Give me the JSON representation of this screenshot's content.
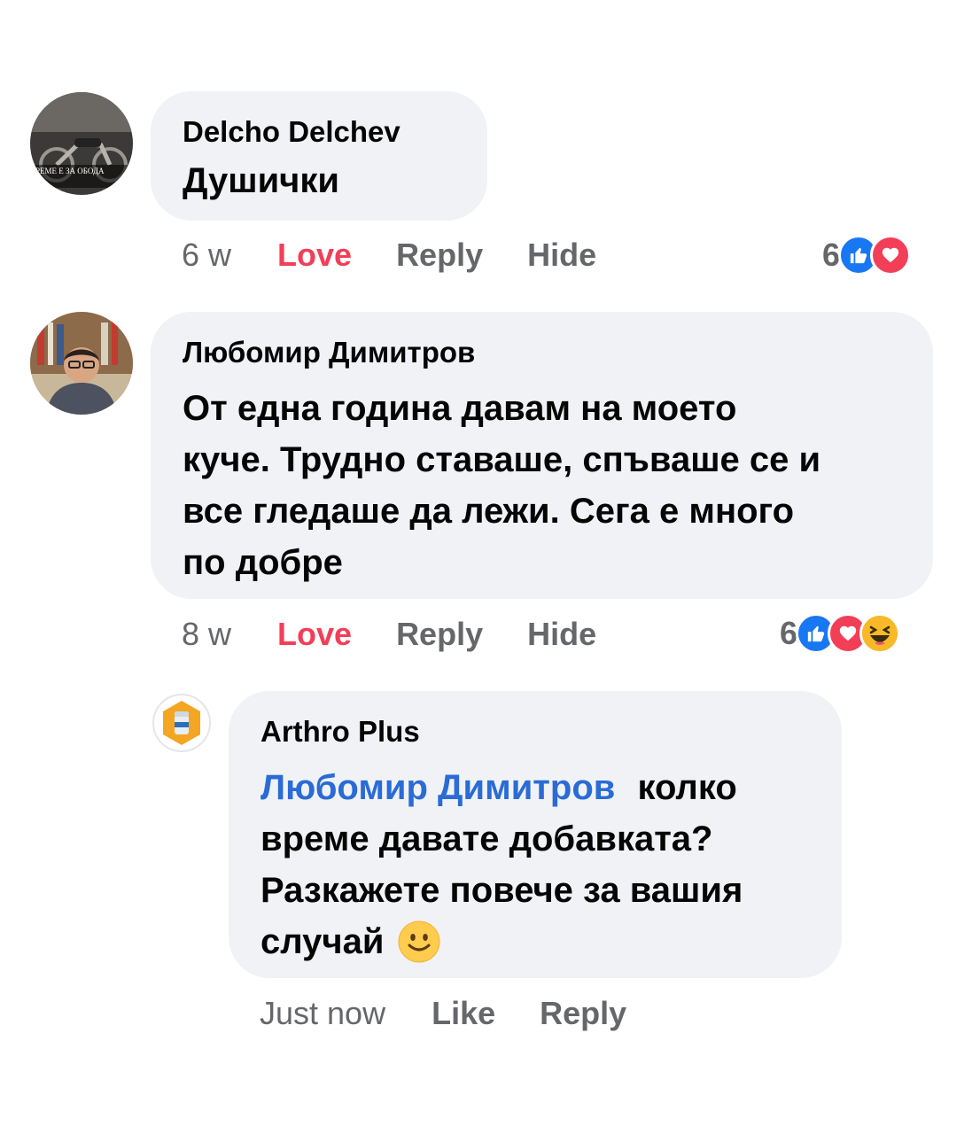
{
  "comments": [
    {
      "author": "Delcho Delchev",
      "avatar_text": "РЕМЕ Е ЗА ОБОДА",
      "text": "Душички",
      "time": "6 w",
      "love_label": "Love",
      "reply_label": "Reply",
      "hide_label": "Hide",
      "reaction_count": "6",
      "reactions": [
        "like-icon",
        "heart-icon"
      ]
    },
    {
      "author": "Любомир Димитров",
      "text_lines": [
        "От една година давам на моето",
        "куче. Трудно ставаше, спъваше се и",
        "все гледаше да лежи. Сега е много",
        "по добре"
      ],
      "time": "8 w",
      "love_label": "Love",
      "reply_label": "Reply",
      "hide_label": "Hide",
      "reaction_count": "6",
      "reactions": [
        "like-icon",
        "heart-icon",
        "haha-icon"
      ]
    }
  ],
  "reply": {
    "author": "Arthro Plus",
    "mention": "Любомир Димитров",
    "text_first": "колко",
    "text_lines": [
      "време давате добавката?",
      "Разкажете повече за вашия"
    ],
    "text_last": "случай",
    "emoji": "slightly-smiling-face-icon",
    "time": "Just now",
    "like_label": "Like",
    "reply_label": "Reply"
  },
  "colors": {
    "love": "#f33e58",
    "like": "#1877f2",
    "mention": "#2a6bd6",
    "bubble": "#f0f2f5",
    "meta": "#65676b"
  }
}
